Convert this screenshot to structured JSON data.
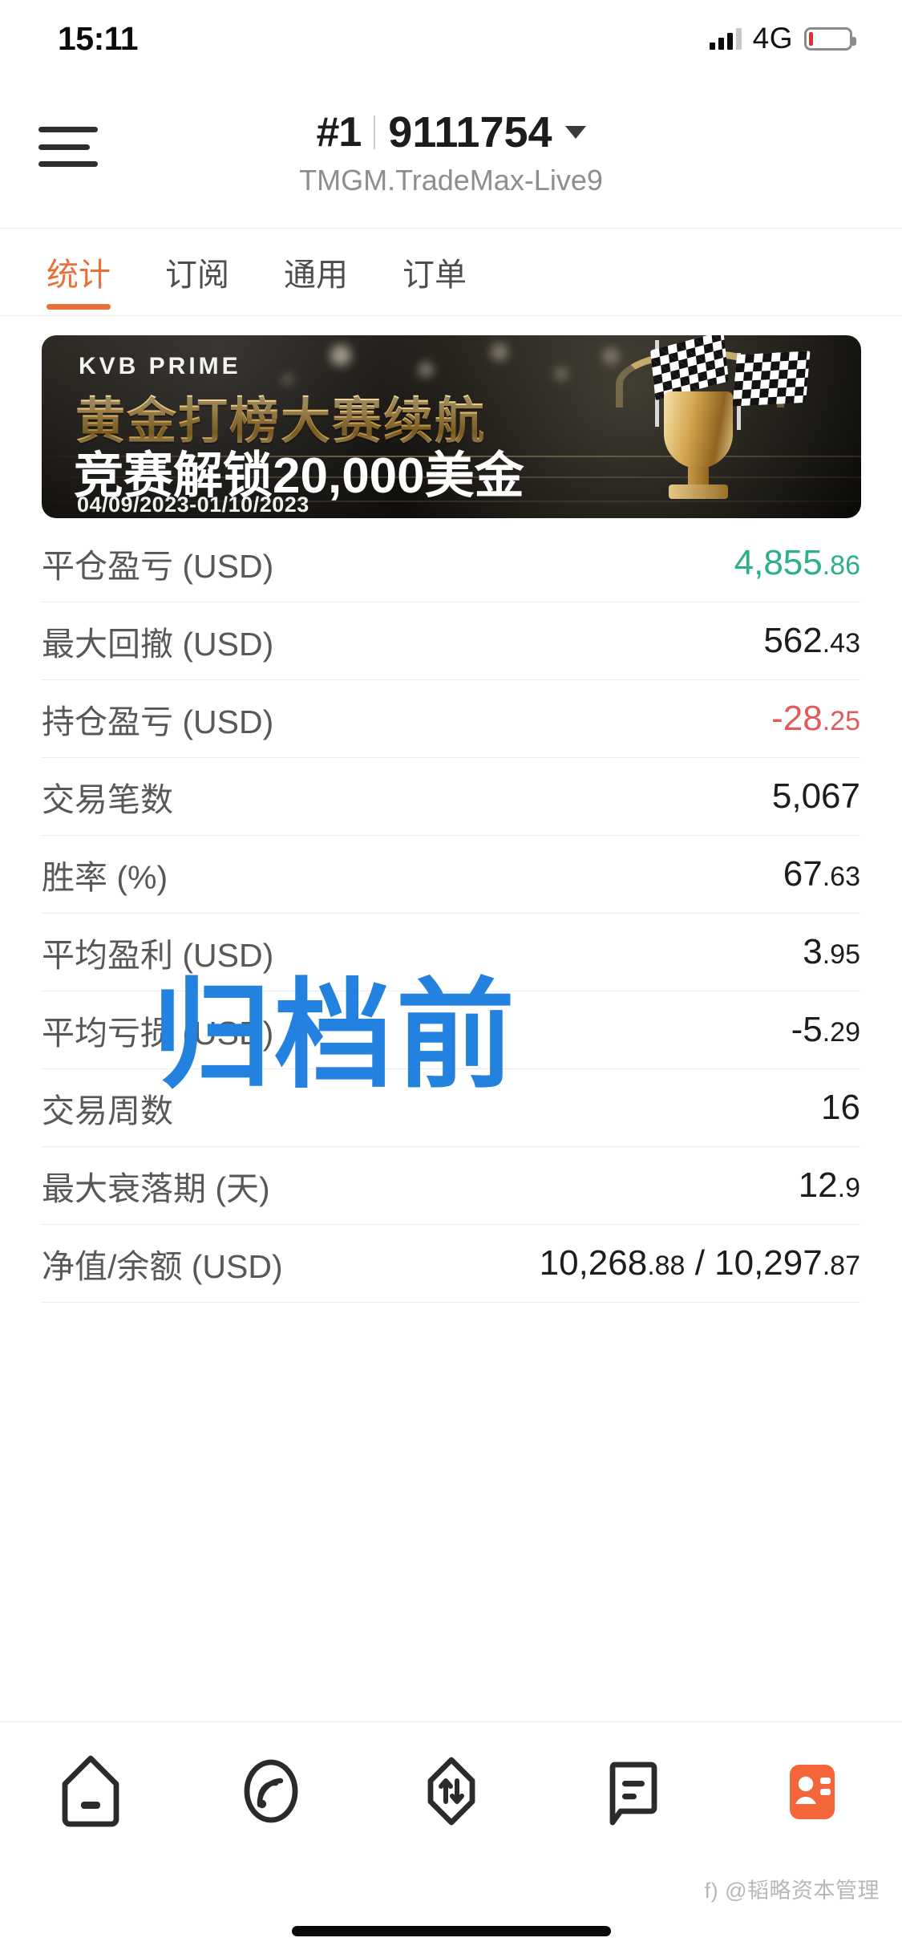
{
  "status_bar": {
    "time": "15:11",
    "network": "4G",
    "signal_icon": "signal-bars-icon",
    "battery_icon": "battery-low-icon",
    "battery_level_pct": 8
  },
  "header": {
    "menu_icon": "hamburger-menu-icon",
    "rank": "#1",
    "account_number": "9111754",
    "dropdown_icon": "chevron-down-icon",
    "server": "TMGM.TradeMax-Live9"
  },
  "tabs": [
    {
      "label": "统计",
      "active": true
    },
    {
      "label": "订阅",
      "active": false
    },
    {
      "label": "通用",
      "active": false
    },
    {
      "label": "订单",
      "active": false
    }
  ],
  "banner": {
    "brand": "KVB PRIME",
    "headline": "黄金打榜大赛续航",
    "subheadline": "竞赛解锁20,000美金",
    "date_range": "04/09/2023-01/10/2023",
    "trophy_icon": "trophy-icon",
    "flag_icon": "checkered-flag-icon"
  },
  "stats": [
    {
      "label": "平仓盈亏 (USD)",
      "int": "4,855",
      "dec": ".86",
      "tone": "pos"
    },
    {
      "label": "最大回撤 (USD)",
      "int": "562",
      "dec": ".43",
      "tone": "neutral"
    },
    {
      "label": "持仓盈亏 (USD)",
      "int": "-28",
      "dec": ".25",
      "tone": "neg"
    },
    {
      "label": "交易笔数",
      "int": "5,067",
      "dec": "",
      "tone": "neutral"
    },
    {
      "label": "胜率 (%)",
      "int": "67",
      "dec": ".63",
      "tone": "neutral"
    },
    {
      "label": "平均盈利 (USD)",
      "int": "3",
      "dec": ".95",
      "tone": "neutral"
    },
    {
      "label": "平均亏损 (USD)",
      "int": "-5",
      "dec": ".29",
      "tone": "neutral"
    },
    {
      "label": "交易周数",
      "int": "16",
      "dec": "",
      "tone": "neutral"
    },
    {
      "label": "最大衰落期 (天)",
      "int": "12",
      "dec": ".9",
      "tone": "neutral"
    },
    {
      "label": "净值/余额 (USD)",
      "int": "10,268",
      "dec": ".88",
      "tone": "neutral",
      "int2": " / 10,297",
      "dec2": ".87"
    }
  ],
  "annotation": {
    "text": "归档前",
    "color": "#2381e0"
  },
  "bottom_nav": [
    {
      "name": "home",
      "icon": "home-icon",
      "active": false
    },
    {
      "name": "signals",
      "icon": "signal-wave-icon",
      "active": false
    },
    {
      "name": "trade",
      "icon": "trade-arrows-icon",
      "active": false
    },
    {
      "name": "chat",
      "icon": "message-icon",
      "active": false
    },
    {
      "name": "profile",
      "icon": "profile-card-icon",
      "active": true
    }
  ],
  "watermark": "f) @韬略资本管理",
  "theme": {
    "accent": "#e8703a",
    "positive": "#2bb08a",
    "negative": "#e05c5c",
    "annotation_blue": "#2381e0"
  }
}
